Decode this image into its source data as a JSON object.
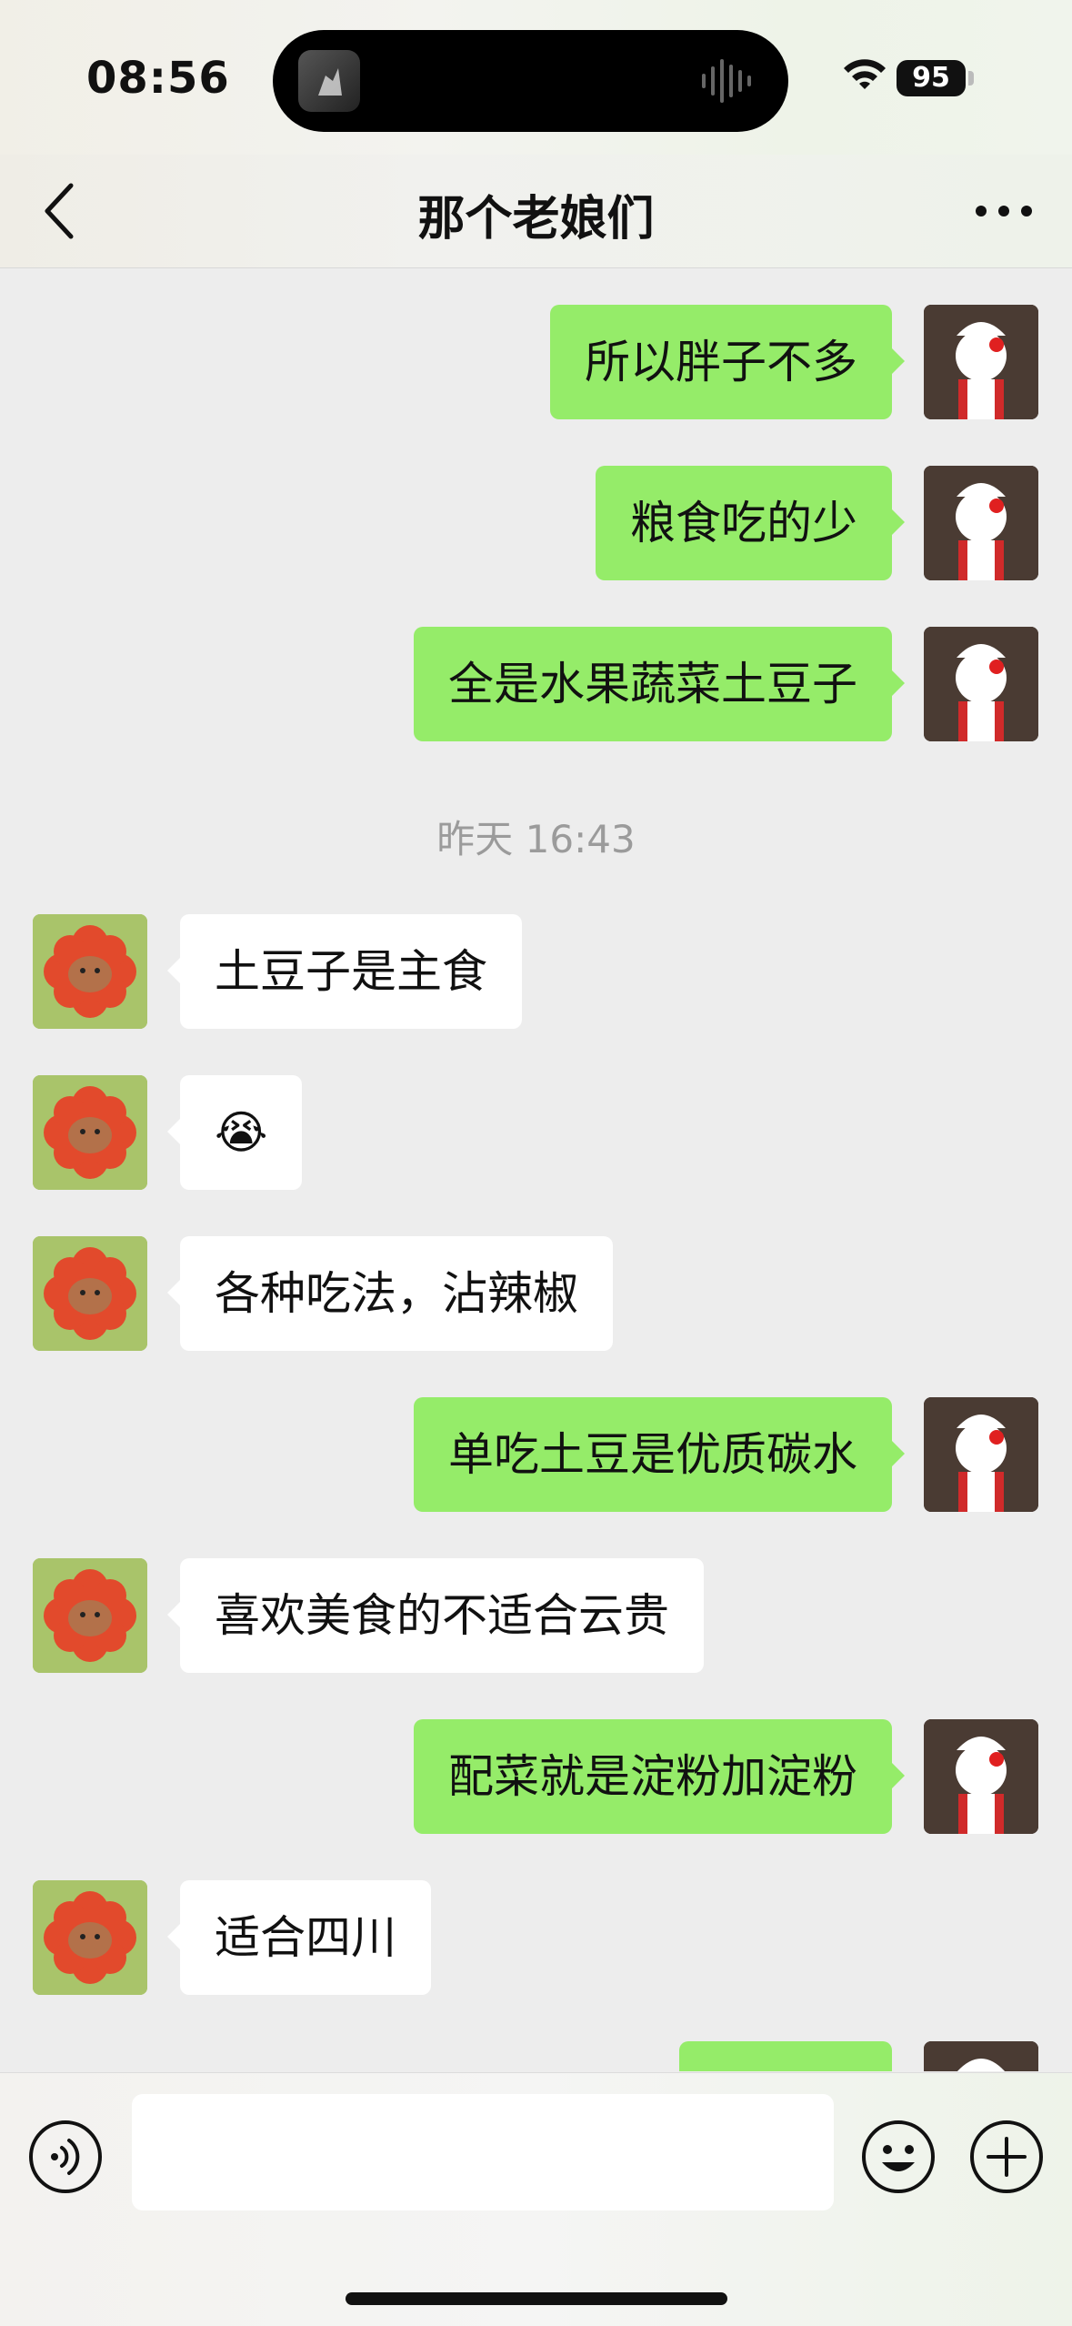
{
  "status_bar": {
    "time": "08:56",
    "battery": "95"
  },
  "navbar": {
    "title": "那个老娘们"
  },
  "messages": [
    {
      "from": "me",
      "text": "所以胖子不多"
    },
    {
      "from": "me",
      "text": "粮食吃的少"
    },
    {
      "from": "me",
      "text": "全是水果蔬菜土豆子"
    },
    {
      "type": "timestamp",
      "text": "昨天 16:43"
    },
    {
      "from": "them",
      "text": "土豆子是主食"
    },
    {
      "from": "them",
      "text": "😭"
    },
    {
      "from": "them",
      "text": "各种吃法，沾辣椒"
    },
    {
      "from": "me",
      "text": "单吃土豆是优质碳水"
    },
    {
      "from": "them",
      "text": "喜欢美食的不适合云贵"
    },
    {
      "from": "me",
      "text": "配菜就是淀粉加淀粉"
    },
    {
      "from": "them",
      "text": "适合四川"
    },
    {
      "from": "me",
      "text": ""
    }
  ],
  "input_bar": {
    "placeholder": ""
  },
  "icons": [
    "back-icon",
    "more-icon",
    "voice-icon",
    "emoji-icon",
    "plus-icon",
    "wifi-icon",
    "battery-icon"
  ],
  "colors": {
    "my_bubble": "#95ec69",
    "their_bubble": "#ffffff",
    "background": "#ededed"
  }
}
